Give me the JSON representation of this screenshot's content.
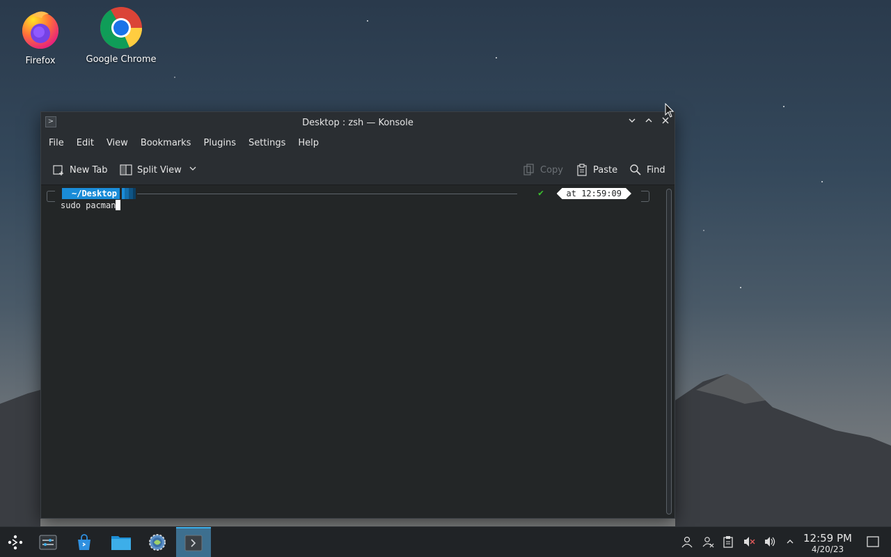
{
  "desktop": {
    "icons": [
      {
        "label": "Firefox",
        "icon": "firefox-icon"
      },
      {
        "label": "Google Chrome",
        "icon": "chrome-icon"
      }
    ]
  },
  "window": {
    "title": "Desktop : zsh — Konsole",
    "controls": [
      "minimize-icon",
      "maximize-icon",
      "close-icon"
    ],
    "menu": [
      "File",
      "Edit",
      "View",
      "Bookmarks",
      "Plugins",
      "Settings",
      "Help"
    ],
    "toolbar": {
      "new_tab": "New Tab",
      "split_view": "Split View",
      "copy": "Copy",
      "paste": "Paste",
      "find": "Find"
    },
    "terminal": {
      "prompt_dir": "~/Desktop",
      "prompt_status": "✔",
      "prompt_time": "at 12:59:09",
      "command": "sudo pacman"
    }
  },
  "taskbar": {
    "launcher": "application-launcher-icon",
    "tasks": [
      "overview-icon",
      "discover-store-icon",
      "file-manager-icon",
      "system-settings-icon",
      "konsole-icon"
    ],
    "active_task": "konsole-icon",
    "tray": [
      "user-icon",
      "accounts-icon",
      "clipboard-icon",
      "muted-speaker-icon",
      "volume-icon",
      "tray-expand-icon"
    ],
    "clock": {
      "time": "12:59 PM",
      "date": "4/20/23"
    },
    "show_desktop": "show-desktop-icon"
  },
  "colors": {
    "accent": "#3daee9",
    "prompt_dir_bg": "#1a8cd8",
    "status_ok": "#3bbf2f",
    "terminal_bg": "#232627"
  }
}
